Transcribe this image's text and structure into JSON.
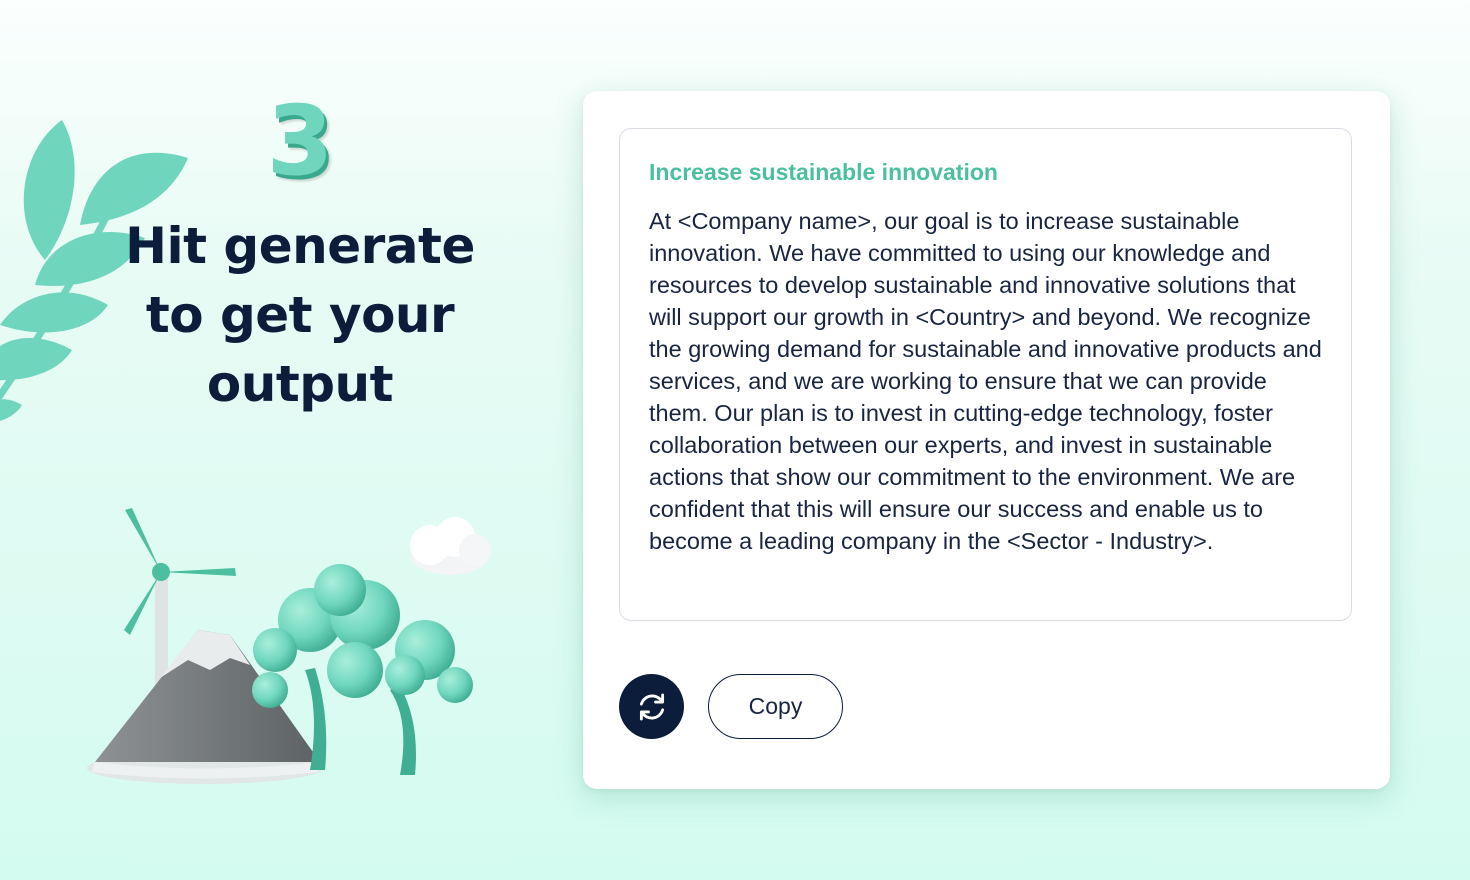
{
  "step": {
    "number": "3",
    "headline": "Hit generate to get your output"
  },
  "output": {
    "title": "Increase sustainable innovation",
    "body": "At <Company name>, our goal is to increase sustainable innovation. We have committed to using our knowledge and resources to develop sustainable and innovative solutions that will support our growth in <Country> and beyond. We recognize the growing demand for sustainable and innovative products and services, and we are working to ensure that we can provide them. Our plan is to invest in cutting-edge technology, foster collaboration between our experts, and invest in sustainable actions that show our commitment to the environment. We are confident that this will ensure our success and enable us to become a leading company in the <Sector - Industry>."
  },
  "actions": {
    "regenerate_icon": "refresh-icon",
    "copy_label": "Copy"
  },
  "colors": {
    "accent": "#4bbf9f",
    "dark": "#0c1c3b",
    "leaf": "#6fd6bd",
    "background": "#d4fbf0"
  },
  "illustration_icons": [
    "leaf-branch-icon",
    "wind-turbine-icon",
    "mountain-icon",
    "tree-icon",
    "cloud-icon"
  ]
}
